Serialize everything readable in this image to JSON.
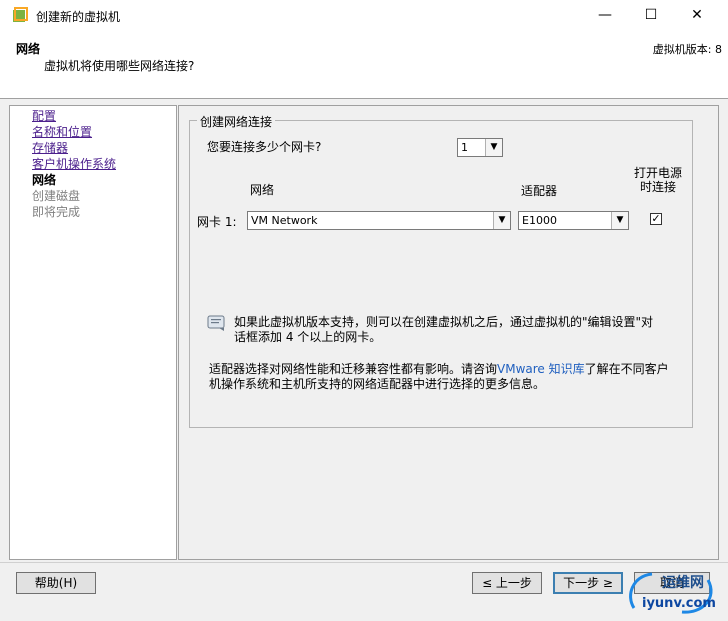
{
  "window": {
    "title": "创建新的虚拟机",
    "icon": "vsphere-vm-icon",
    "minimize_glyph": "—",
    "maximize_glyph": "☐",
    "close_glyph": "✕"
  },
  "header": {
    "title": "网络",
    "subtitle": "虚拟机将使用哪些网络连接?",
    "version": "虚拟机版本: 8"
  },
  "nav": {
    "items": [
      {
        "label": "配置",
        "state": "link"
      },
      {
        "label": "名称和位置",
        "state": "link"
      },
      {
        "label": "存储器",
        "state": "link"
      },
      {
        "label": "客户机操作系统",
        "state": "link"
      },
      {
        "label": "网络",
        "state": "current"
      },
      {
        "label": "创建磁盘",
        "state": "future"
      },
      {
        "label": "即将完成",
        "state": "future"
      }
    ]
  },
  "network": {
    "group_label": "创建网络连接",
    "nic_count_question": "您要连接多少个网卡?",
    "nic_count_value": "1",
    "col_network": "网络",
    "col_adapter": "适配器",
    "col_power_on": "打开电源时连接",
    "row": {
      "label": "网卡 1:",
      "network_value": "VM Network",
      "adapter_value": "E1000",
      "connect_at_power_on": true,
      "check_glyph": "✓"
    },
    "info_text": "如果此虚拟机版本支持，则可以在创建虚拟机之后，通过虚拟机的\"编辑设置\"对话框添加 4 个以上的网卡。",
    "adapter_note_prefix": "适配器选择对网络性能和迁移兼容性都有影响。请咨询",
    "adapter_note_link": "VMware 知识库",
    "adapter_note_suffix": "了解在不同客户机操作系统和主机所支持的网络适配器中进行选择的更多信息。"
  },
  "buttons": {
    "help": "帮助(H)",
    "back": "≤ 上一步",
    "next": "下一步 ≥",
    "cancel": "取消"
  },
  "watermark": {
    "text": "iyunv.com",
    "subtext": "运维网"
  },
  "colors": {
    "link": "#4b1f8c",
    "kb_link": "#1f5fbf",
    "accent_border": "#3c7fb1"
  }
}
